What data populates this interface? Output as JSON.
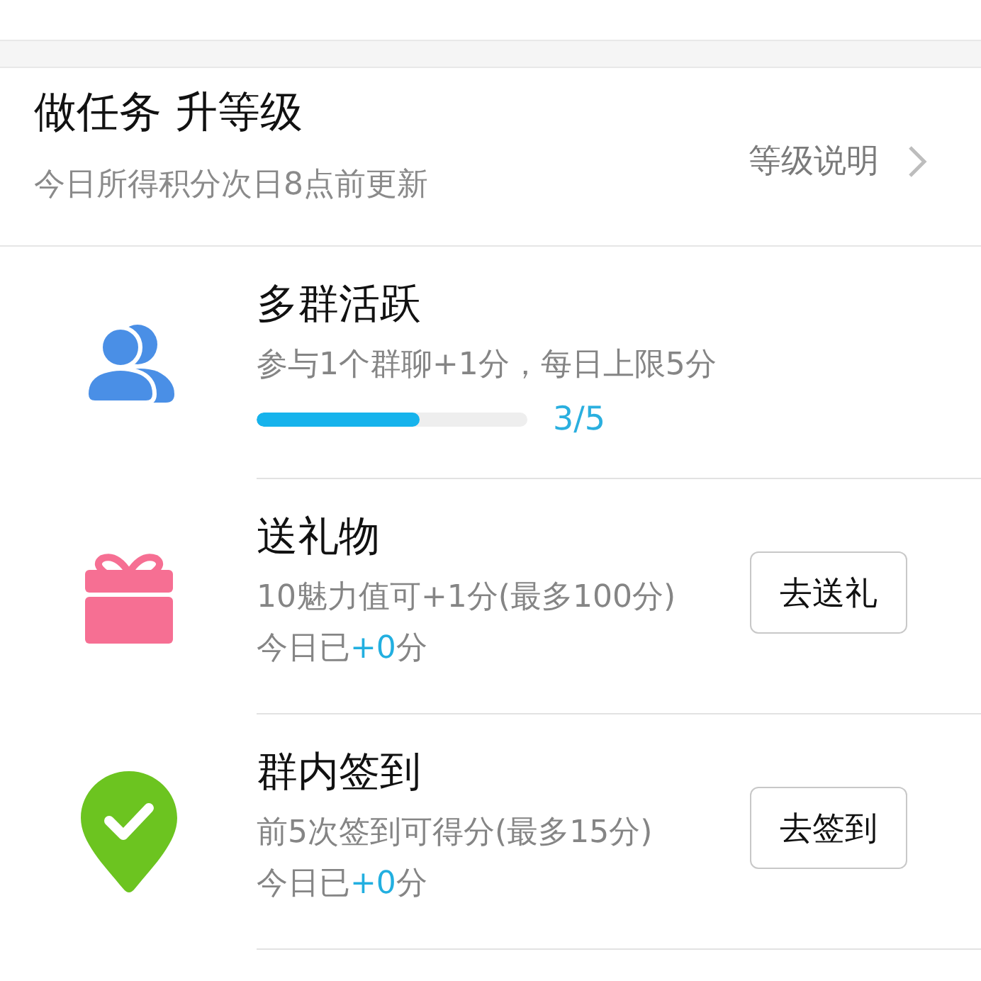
{
  "header": {
    "title": "做任务 升等级",
    "subtitle": "今日所得积分次日8点前更新",
    "link": "等级说明"
  },
  "tasks": [
    {
      "kind": "progress",
      "title": "多群活跃",
      "description": "参与1个群聊+1分，每日上限5分",
      "progress": {
        "level": 0.6,
        "reading": "3/5"
      }
    },
    {
      "kind": "action",
      "title": "送礼物",
      "description": "10魅力值可+1分(最多100分)",
      "today": {
        "label": "今日已",
        "points": "+0",
        "unit": "分"
      },
      "button": "去送礼"
    },
    {
      "kind": "action",
      "title": "群内签到",
      "description": "前5次签到可得分(最多15分)",
      "today": {
        "label": "今日已",
        "points": "+0",
        "unit": "分"
      },
      "button": "去签到"
    }
  ]
}
